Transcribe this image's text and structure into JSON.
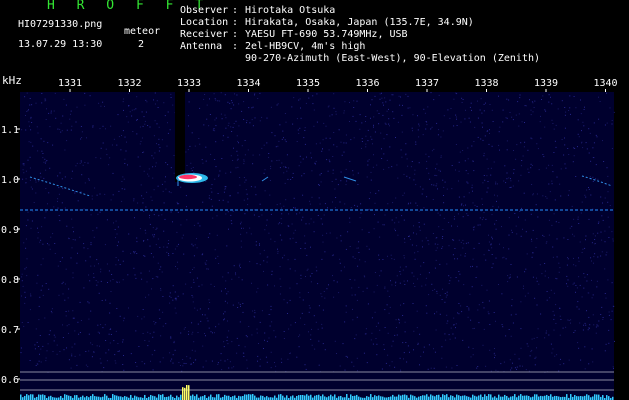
{
  "header": {
    "brand": "H R O F F T",
    "filename": "HI07291330.png",
    "datetime": "13.07.29 13:30",
    "meteor_label": "meteor",
    "meteor_count": "2",
    "observer_label": "Observer",
    "observer_value": "Hirotaka Otsuka",
    "location_label": "Location",
    "location_value": "Hirakata, Osaka, Japan (135.7E, 34.9N)",
    "receiver_label": "Receiver",
    "receiver_value": "YAESU FT-690 53.749MHz, USB",
    "antenna_label": "Antenna",
    "antenna_value": "2el-HB9CV, 4m's high",
    "antenna_value2": "90-270-Azimuth (East-West), 90-Elevation (Zenith)",
    "colon": ":"
  },
  "spectrogram": {
    "y_unit": "kHz",
    "time_labels": [
      "1331",
      "1332",
      "1333",
      "1334",
      "1335",
      "1336",
      "1337",
      "1338",
      "1339",
      "1340"
    ],
    "freq_labels": [
      "1.1",
      "1.0",
      "0.9",
      "0.8",
      "0.7",
      "0.6"
    ],
    "colors": {
      "background": "#000033",
      "text_green": "#33e633",
      "signal_cyan": "#33ccff",
      "meteor_red": "#ff3366",
      "label_yellow": "#ffff66"
    }
  }
}
